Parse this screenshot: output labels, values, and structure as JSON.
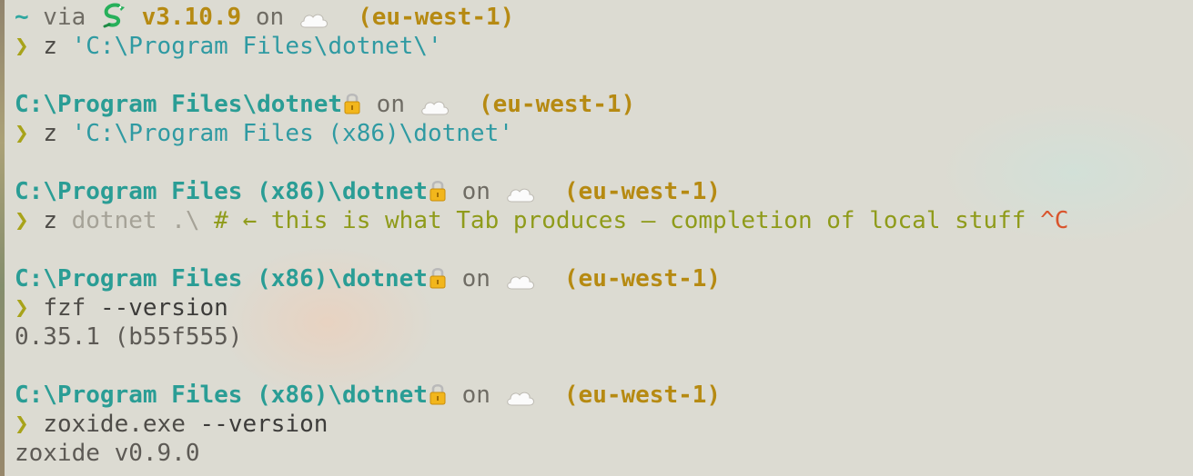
{
  "terminal": {
    "line1": {
      "tilde": "~",
      "via": " via ",
      "version": "v3.10.9",
      "on": " on ",
      "region": "(eu-west-1)"
    },
    "cmd1": {
      "prompt": "❯",
      "cmd": "z",
      "arg": "'C:\\Program Files\\dotnet\\'"
    },
    "block2": {
      "path": "C:\\Program Files\\dotnet",
      "on": " on ",
      "region": "(eu-west-1)"
    },
    "cmd2": {
      "prompt": "❯",
      "cmd": "z",
      "arg": "'C:\\Program Files (x86)\\dotnet'"
    },
    "block3": {
      "path": "C:\\Program Files (x86)\\dotnet",
      "on": " on ",
      "region": "(eu-west-1)"
    },
    "cmd3": {
      "prompt": "❯",
      "cmd": "z",
      "ghost": "dotnet .\\",
      "comment": "# ← this is what Tab produces – completion of local stuff",
      "ctrl": "^C"
    },
    "block4": {
      "path": "C:\\Program Files (x86)\\dotnet",
      "on": " on ",
      "region": "(eu-west-1)"
    },
    "cmd4": {
      "prompt": "❯",
      "cmd": "fzf",
      "arg": "--version"
    },
    "out4": "0.35.1 (b55f555)",
    "block5": {
      "path": "C:\\Program Files (x86)\\dotnet",
      "on": " on ",
      "region": "(eu-west-1)"
    },
    "cmd5": {
      "prompt": "❯",
      "cmd": "zoxide.exe",
      "arg": "--version"
    },
    "out5": "zoxide v0.9.0"
  },
  "colors": {
    "background": "#dcdbd2",
    "path": "#2a9d95",
    "region": "#b68a12",
    "prompt": "#a8a31a",
    "comment": "#8f9b1a",
    "ctrl": "#d9542c"
  },
  "icons": {
    "python": "snake-icon",
    "aws": "cloud-icon",
    "readonly": "lock-icon"
  }
}
